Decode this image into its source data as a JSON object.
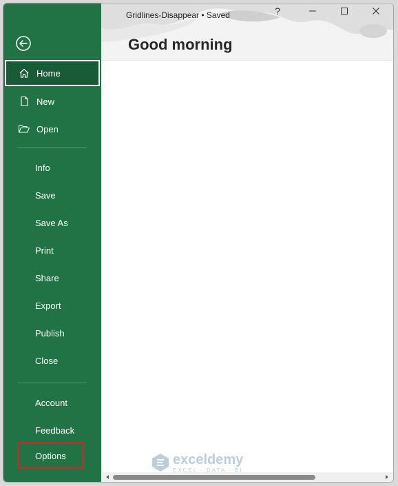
{
  "window": {
    "title": "Gridlines-Disappear • Saved",
    "controls": {
      "help": "?"
    }
  },
  "header": {
    "greeting": "Good morning"
  },
  "sidebar": {
    "back_icon": "back-arrow-icon",
    "items": [
      {
        "label": "Home",
        "icon": "home-icon",
        "active": true
      },
      {
        "label": "New",
        "icon": "new-document-icon"
      },
      {
        "label": "Open",
        "icon": "open-folder-icon"
      },
      {
        "label": "Info"
      },
      {
        "label": "Save"
      },
      {
        "label": "Save As"
      },
      {
        "label": "Print"
      },
      {
        "label": "Share"
      },
      {
        "label": "Export"
      },
      {
        "label": "Publish"
      },
      {
        "label": "Close"
      },
      {
        "label": "Account"
      },
      {
        "label": "Feedback"
      },
      {
        "label": "Options",
        "highlighted": true
      }
    ]
  },
  "watermark": {
    "name": "exceldemy",
    "tagline": "EXCEL · DATA · BI"
  },
  "colors": {
    "sidebar": "#217346",
    "sidebar_active": "#185c37",
    "highlight_border": "#e02020"
  }
}
